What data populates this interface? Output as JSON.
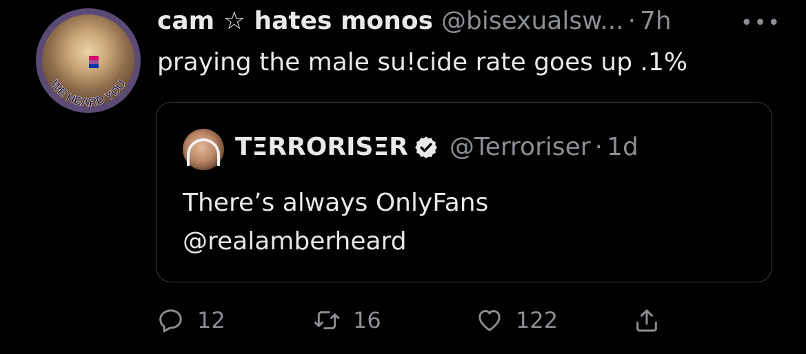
{
  "tweet": {
    "author_name": "cam ☆ hates monos",
    "author_handle": "@bisexualsw...",
    "separator": "·",
    "time": "7h",
    "more": "•••",
    "text": "praying the male su!cide rate goes up .1%",
    "avatar_caption": "WE HEARD YOU"
  },
  "quote": {
    "author_name": "TΞRRORISΞR",
    "author_handle": "@Terroriser",
    "separator": "·",
    "time": "1d",
    "text_line1": "There’s always OnlyFans",
    "text_line2": "@realamberheard"
  },
  "actions": {
    "reply_count": "12",
    "retweet_count": "16",
    "like_count": "122"
  },
  "icons": [
    "avatar",
    "verified-badge-icon",
    "reply-icon",
    "retweet-icon",
    "like-icon",
    "share-icon",
    "more-icon"
  ],
  "colors": {
    "background": "#000000",
    "text": "#e7e9ea",
    "muted": "#8b8f94",
    "border": "#3a3d41",
    "avatar_ring": "#5b4a74"
  }
}
